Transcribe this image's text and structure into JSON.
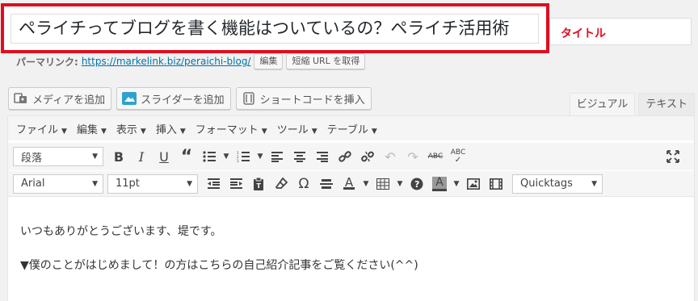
{
  "title": {
    "value": "ペライチってブログを書く機能はついているの？ペライチ活用術",
    "annotation": "タイトル",
    "annotation_color": "#e00d1f"
  },
  "permalink": {
    "label": "パーマリンク:",
    "url": "https://markelink.biz/peraichi-blog/",
    "edit_label": "編集",
    "shortlink_label": "短縮 URL を取得"
  },
  "media_buttons": [
    {
      "label": "メディアを追加",
      "icon": "media-icon"
    },
    {
      "label": "スライダーを追加",
      "icon": "slider-icon"
    },
    {
      "label": "ショートコードを挿入",
      "icon": "shortcode-icon"
    }
  ],
  "tabs": [
    {
      "label": "ビジュアル",
      "active": true
    },
    {
      "label": "テキスト",
      "active": false
    }
  ],
  "menubar": [
    "ファイル",
    "編集",
    "表示",
    "挿入",
    "フォーマット",
    "ツール",
    "テーブル"
  ],
  "toolbar1": {
    "format_select": "段落"
  },
  "toolbar2": {
    "font_select": "Arial",
    "size_select": "11pt",
    "quicktags_select": "Quicktags"
  },
  "content": [
    "いつもありがとうございます、堤です。",
    "▼僕のことがはじめまして！の方はこちらの自己紹介記事をご覧ください(^^)"
  ]
}
